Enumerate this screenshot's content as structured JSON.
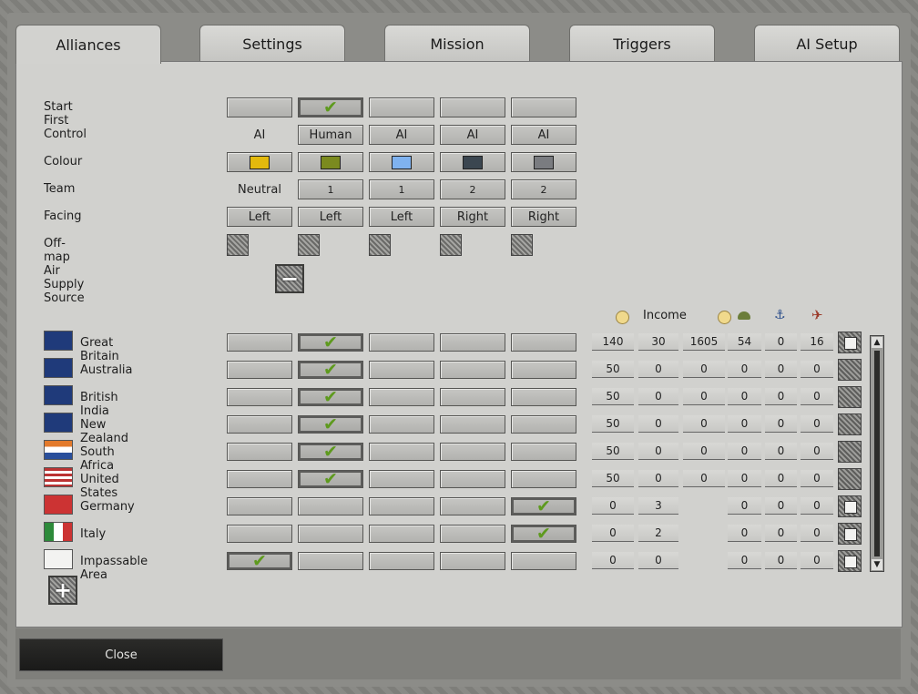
{
  "tabs": [
    "Alliances",
    "Settings",
    "Mission",
    "Triggers",
    "AI Setup"
  ],
  "rows": {
    "start_first": "Start First",
    "control": "Control",
    "colour": "Colour",
    "team": "Team",
    "facing": "Facing",
    "airsupply": "Off-map Air Supply Source"
  },
  "alliance_columns": [
    {
      "start_first": false,
      "control": "AI",
      "control_style": "plain",
      "colour": "#e3b90d",
      "team": "Neutral",
      "team_style": "plain",
      "facing": "Left"
    },
    {
      "start_first": true,
      "control": "Human",
      "control_style": "button",
      "colour": "#7b8a1f",
      "team": "1",
      "team_style": "button",
      "facing": "Left"
    },
    {
      "start_first": false,
      "control": "AI",
      "control_style": "button",
      "colour": "#7fb2ef",
      "team": "1",
      "team_style": "button",
      "facing": "Left"
    },
    {
      "start_first": false,
      "control": "AI",
      "control_style": "button",
      "colour": "#3b4650",
      "team": "2",
      "team_style": "button",
      "facing": "Right"
    },
    {
      "start_first": false,
      "control": "AI",
      "control_style": "button",
      "colour": "#7a7c80",
      "team": "2",
      "team_style": "button",
      "facing": "Right"
    }
  ],
  "resource_header": {
    "income_label": "Income",
    "icons": [
      "coin-icon",
      "coin-icon",
      "helmet-icon",
      "anchor-icon",
      "plane-icon"
    ]
  },
  "nations": [
    {
      "name": "Great Britain",
      "flag": "uk-flag",
      "alliance": 1,
      "values": [
        "140",
        "30",
        "1605",
        "54",
        "0",
        "16"
      ],
      "toggle": "white"
    },
    {
      "name": "Australia",
      "flag": "australia-flag",
      "alliance": 1,
      "values": [
        "50",
        "0",
        "0",
        "0",
        "0",
        "0"
      ],
      "toggle": "mesh"
    },
    {
      "name": "British India",
      "flag": "british-india-flag",
      "alliance": 1,
      "values": [
        "50",
        "0",
        "0",
        "0",
        "0",
        "0"
      ],
      "toggle": "mesh"
    },
    {
      "name": "New Zealand",
      "flag": "new-zealand-flag",
      "alliance": 1,
      "values": [
        "50",
        "0",
        "0",
        "0",
        "0",
        "0"
      ],
      "toggle": "mesh"
    },
    {
      "name": "South Africa",
      "flag": "south-africa-flag",
      "alliance": 1,
      "values": [
        "50",
        "0",
        "0",
        "0",
        "0",
        "0"
      ],
      "toggle": "mesh"
    },
    {
      "name": "United States",
      "flag": "usa-flag",
      "alliance": 1,
      "values": [
        "50",
        "0",
        "0",
        "0",
        "0",
        "0"
      ],
      "toggle": "mesh"
    },
    {
      "name": "Germany",
      "flag": "germany-flag",
      "alliance": 4,
      "values": [
        "0",
        "3",
        "",
        "0",
        "0",
        "0"
      ],
      "toggle": "white"
    },
    {
      "name": "Italy",
      "flag": "italy-flag",
      "alliance": 4,
      "values": [
        "0",
        "2",
        "",
        "0",
        "0",
        "0"
      ],
      "toggle": "white"
    },
    {
      "name": "Impassable Area",
      "flag": "impassable-flag",
      "alliance": 0,
      "values": [
        "0",
        "0",
        "",
        "0",
        "0",
        "0"
      ],
      "toggle": "white"
    }
  ],
  "close_label": "Close",
  "check_glyph": "✔",
  "minus_glyph": "−",
  "plus_glyph": "+"
}
